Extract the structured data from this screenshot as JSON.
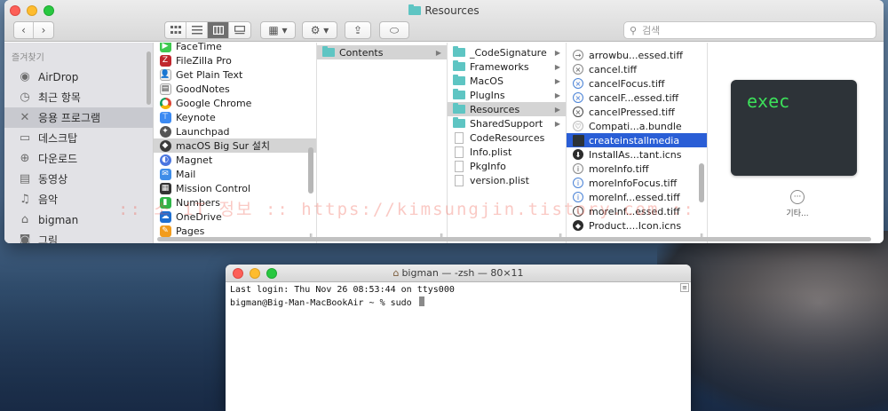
{
  "finder": {
    "title": "Resources",
    "search_placeholder": "검색",
    "toolbar": {
      "back": "‹",
      "forward": "›",
      "share": "⇪",
      "tag": "⬭",
      "gear": "⚙ ▾",
      "group": "▦ ▾"
    },
    "sidebar": {
      "header": "즐겨찾기",
      "items": [
        {
          "label": "AirDrop",
          "icon": "airdrop-icon"
        },
        {
          "label": "최근 항목",
          "icon": "clock-icon"
        },
        {
          "label": "응용 프로그램",
          "icon": "applications-icon"
        },
        {
          "label": "데스크탑",
          "icon": "desktop-icon"
        },
        {
          "label": "다운로드",
          "icon": "download-icon"
        },
        {
          "label": "동영상",
          "icon": "movie-icon"
        },
        {
          "label": "음악",
          "icon": "music-icon"
        },
        {
          "label": "bigman",
          "icon": "home-icon"
        },
        {
          "label": "그림",
          "icon": "camera-icon"
        }
      ]
    },
    "col1": [
      "FaceTime",
      "FileZilla Pro",
      "Get Plain Text",
      "GoodNotes",
      "Google Chrome",
      "Keynote",
      "Launchpad",
      "macOS Big Sur 설치",
      "Magnet",
      "Mail",
      "Mission Control",
      "Numbers",
      "OneDrive",
      "Pages"
    ],
    "col2": [
      "Contents"
    ],
    "col3": [
      "_CodeSignature",
      "Frameworks",
      "MacOS",
      "PlugIns",
      "Resources",
      "SharedSupport",
      "CodeResources",
      "Info.plist",
      "PkgInfo",
      "version.plist"
    ],
    "col4": [
      "arrowbu...essed.tiff",
      "cancel.tiff",
      "cancelFocus.tiff",
      "cancelF...essed.tiff",
      "cancelPressed.tiff",
      "Compati...a.bundle",
      "createinstallmedia",
      "InstallAs...tant.icns",
      "moreInfo.tiff",
      "moreInfoFocus.tiff",
      "moreInf...essed.tiff",
      "moreInf...essed.tiff",
      "Product....Icon.icns"
    ],
    "preview": {
      "thumb_text": "exec",
      "more_label": "기타..."
    },
    "watermark": ":: 소 iT 정보 :: https://kimsungjin.tistory.com ::"
  },
  "terminal": {
    "title": "bigman — -zsh — 80×11",
    "line1": "Last login: Thu Nov 26 08:53:44 on ttys000",
    "line2": "bigman@Big-Man-MacBookAir ~ % sudo "
  }
}
